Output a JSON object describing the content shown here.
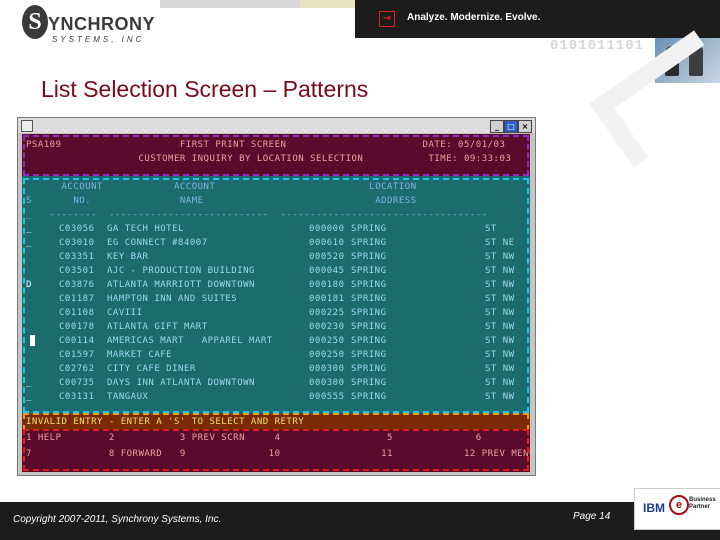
{
  "brand": {
    "logo_letter": "S",
    "logo_name": "YNCHRONY",
    "logo_sub": "SYSTEMS, INC",
    "tagline": "Analyze. Modernize. Evolve.",
    "binary": "0101011101"
  },
  "slide": {
    "title": "List Selection Screen – Patterns",
    "copyright": "Copyright 2007-2011, Synchrony Systems, Inc.",
    "page": "Page 14",
    "partner_ibm": "IBM",
    "partner_at": "e",
    "partner_line1": "Business",
    "partner_line2": "Partner"
  },
  "colors": {
    "accent_title": "#7a0a1a",
    "header_bg": "#5a0b2c",
    "body_bg": "#1b6c6c",
    "message_bg": "#7a2a06",
    "outline_header": "#8a2fbf",
    "outline_list": "#25c4e6",
    "outline_message": "#f29a1e",
    "outline_fkeys": "#e02020"
  },
  "window": {
    "sys_icon": "app-icon",
    "min_glyph": "_",
    "max_glyph": "□",
    "close_glyph": "×"
  },
  "terminal": {
    "header": [
      "PSA109                    FIRST PRINT SCREEN                       DATE: 05/01/03",
      "                   CUSTOMER INQUIRY BY LOCATION SELECTION           TIME: 09:33:03"
    ],
    "column_headers": [
      "      ACCOUNT            ACCOUNT                          LOCATION",
      "S       NO.               NAME                             ADDRESS",
      "_   --------  ---------------------------  -----------------------------------"
    ],
    "rows": [
      {
        "sel": "_",
        "acct": "C03056",
        "name": "GA TECH HOTEL",
        "num": "000000",
        "street": "SPRING",
        "dir": "ST"
      },
      {
        "sel": "_",
        "acct": "C03010",
        "name": "EG CONNECT #84007",
        "num": "000610",
        "street": "SPRING",
        "dir": "ST NE"
      },
      {
        "sel": "",
        "acct": "C03351",
        "name": "KEY BAR",
        "num": "000520",
        "street": "SPRING",
        "dir": "ST NW"
      },
      {
        "sel": "",
        "acct": "C03501",
        "name": "AJC - PRODUCTION BUILDING",
        "num": "000045",
        "street": "SPRING",
        "dir": "ST NW"
      },
      {
        "sel": "D",
        "acct": "C03876",
        "name": "ATLANTA MARRIOTT DOWNTOWN",
        "num": "000180",
        "street": "SPRING",
        "dir": "ST NW"
      },
      {
        "sel": "",
        "acct": "C01187",
        "name": "HAMPTON INN AND SUITES",
        "num": "000181",
        "street": "SPRING",
        "dir": "ST NW"
      },
      {
        "sel": "",
        "acct": "C01108",
        "name": "CAVIII",
        "num": "000225",
        "street": "SPRING",
        "dir": "ST NW"
      },
      {
        "sel": "",
        "acct": "C00178",
        "name": "ATLANTA GIFT MART",
        "num": "000230",
        "street": "SPRING",
        "dir": "ST NW"
      },
      {
        "sel": "",
        "acct": "C00114",
        "name": "AMERICAS MART   APPAREL MART",
        "num": "000250",
        "street": "SPRING",
        "dir": "ST NW"
      },
      {
        "sel": "",
        "acct": "C01597",
        "name": "MARKET CAFE",
        "num": "000250",
        "street": "SPRING",
        "dir": "ST NW"
      },
      {
        "sel": "",
        "acct": "C02762",
        "name": "CITY CAFE DINER",
        "num": "000300",
        "street": "SPRING",
        "dir": "ST NW"
      },
      {
        "sel": "_",
        "acct": "C00735",
        "name": "DAYS INN ATLANTA DOWNTOWN",
        "num": "000300",
        "street": "SPRING",
        "dir": "ST NW"
      },
      {
        "sel": "_",
        "acct": "C03131",
        "name": "TANGAUX",
        "num": "000555",
        "street": "SPRING",
        "dir": "ST NW"
      }
    ],
    "message": "INVALID ENTRY - ENTER A 'S' TO SELECT AND RETRY",
    "fkeys_line1": "1 HELP        2           3 PREV SCRN     4                  5              6",
    "fkeys_line2": "7             8 FORWARD   9              10                 11            12 PREV MENU"
  }
}
